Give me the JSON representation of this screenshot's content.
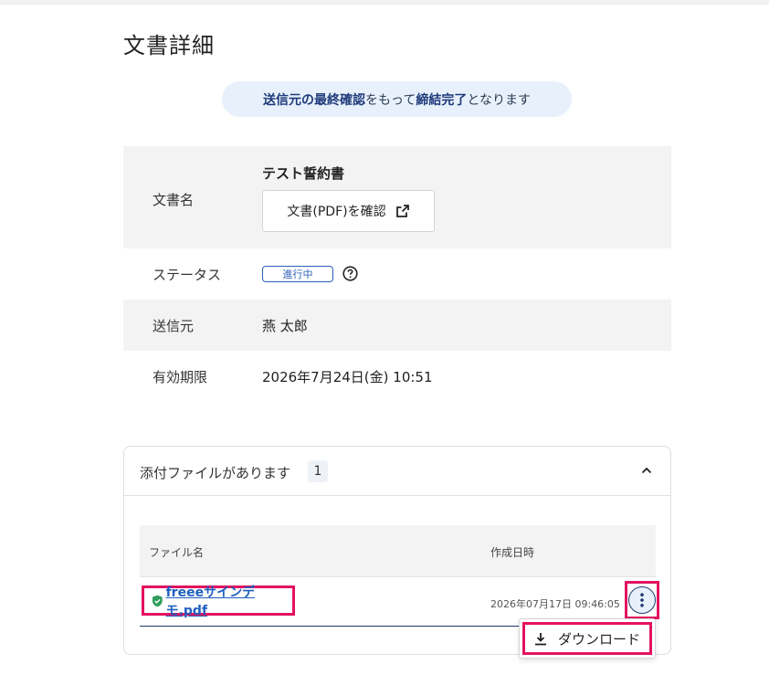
{
  "page": {
    "title": "文書詳細"
  },
  "notice": {
    "part1": "送信元の最終確認",
    "part2": "をもって",
    "part3": "締結完了",
    "part4": "となります"
  },
  "document": {
    "name_label": "文書名",
    "name_value": "テスト誓約書",
    "pdf_button_label": "文書(PDF)を確認",
    "status_label": "ステータス",
    "status_value": "進行中",
    "sender_label": "送信元",
    "sender_value": "燕 太郎",
    "expiry_label": "有効期限",
    "expiry_value": "2026年7月24日(金) 10:51"
  },
  "attachments": {
    "title": "添付ファイルがあります",
    "count": "1",
    "columns": {
      "file_name": "ファイル名",
      "created_at": "作成日時"
    },
    "files": [
      {
        "name": "freeeサインデモ.pdf",
        "created_at": "2026年07月17日 09:46:05"
      }
    ]
  },
  "menu": {
    "download_label": "ダウンロード"
  },
  "colors": {
    "accent": "#2c5fb8",
    "highlight": "#e4125f",
    "notice_bg": "#e8f1fb",
    "shield": "#2e9e5b"
  }
}
